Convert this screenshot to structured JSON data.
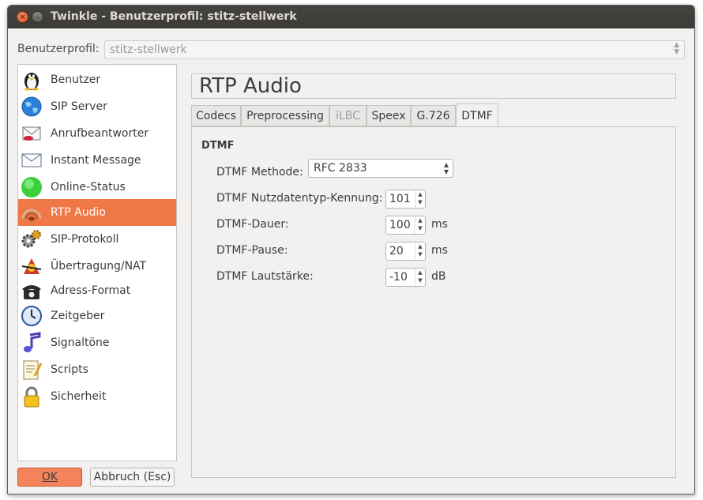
{
  "window": {
    "title": "Twinkle - Benutzerprofil: stitz-stellwerk"
  },
  "profile": {
    "label": "Benutzerprofil:",
    "value": "stitz-stellwerk"
  },
  "sidebar": {
    "items": [
      {
        "label": "Benutzer",
        "icon": "penguin-icon"
      },
      {
        "label": "SIP Server",
        "icon": "globe-icon"
      },
      {
        "label": "Anrufbeantworter",
        "icon": "voicemail-icon"
      },
      {
        "label": "Instant Message",
        "icon": "envelope-icon"
      },
      {
        "label": "Online-Status",
        "icon": "green-light-icon"
      },
      {
        "label": "RTP Audio",
        "icon": "audio-icon"
      },
      {
        "label": "SIP-Protokoll",
        "icon": "gears-icon"
      },
      {
        "label": "Übertragung/NAT",
        "icon": "network-icon"
      },
      {
        "label": "Adress-Format",
        "icon": "telephone-icon"
      },
      {
        "label": "Zeitgeber",
        "icon": "clock-icon"
      },
      {
        "label": "Signaltöne",
        "icon": "music-note-icon"
      },
      {
        "label": "Scripts",
        "icon": "script-icon"
      },
      {
        "label": "Sicherheit",
        "icon": "padlock-icon"
      }
    ],
    "active_index": 5
  },
  "buttons": {
    "ok": "OK",
    "cancel": "Abbruch (Esc)"
  },
  "page": {
    "title": "RTP Audio"
  },
  "tabs": [
    {
      "label": "Codecs"
    },
    {
      "label": "Preprocessing"
    },
    {
      "label": "iLBC"
    },
    {
      "label": "Speex"
    },
    {
      "label": "G.726"
    },
    {
      "label": "DTMF"
    }
  ],
  "dtmf": {
    "group_title": "DTMF",
    "method": {
      "label": "DTMF Methode:",
      "value": "RFC 2833"
    },
    "payload": {
      "label": "DTMF Nutzdatentyp-Kennung:",
      "value": "101"
    },
    "duration": {
      "label": "DTMF-Dauer:",
      "value": "100",
      "unit": "ms"
    },
    "pause": {
      "label": "DTMF-Pause:",
      "value": "20",
      "unit": "ms"
    },
    "volume": {
      "label": "DTMF Lautstärke:",
      "value": "-10",
      "unit": "dB"
    }
  },
  "colors": {
    "accent": "#f07746",
    "titlebar": "#3c3b37"
  }
}
